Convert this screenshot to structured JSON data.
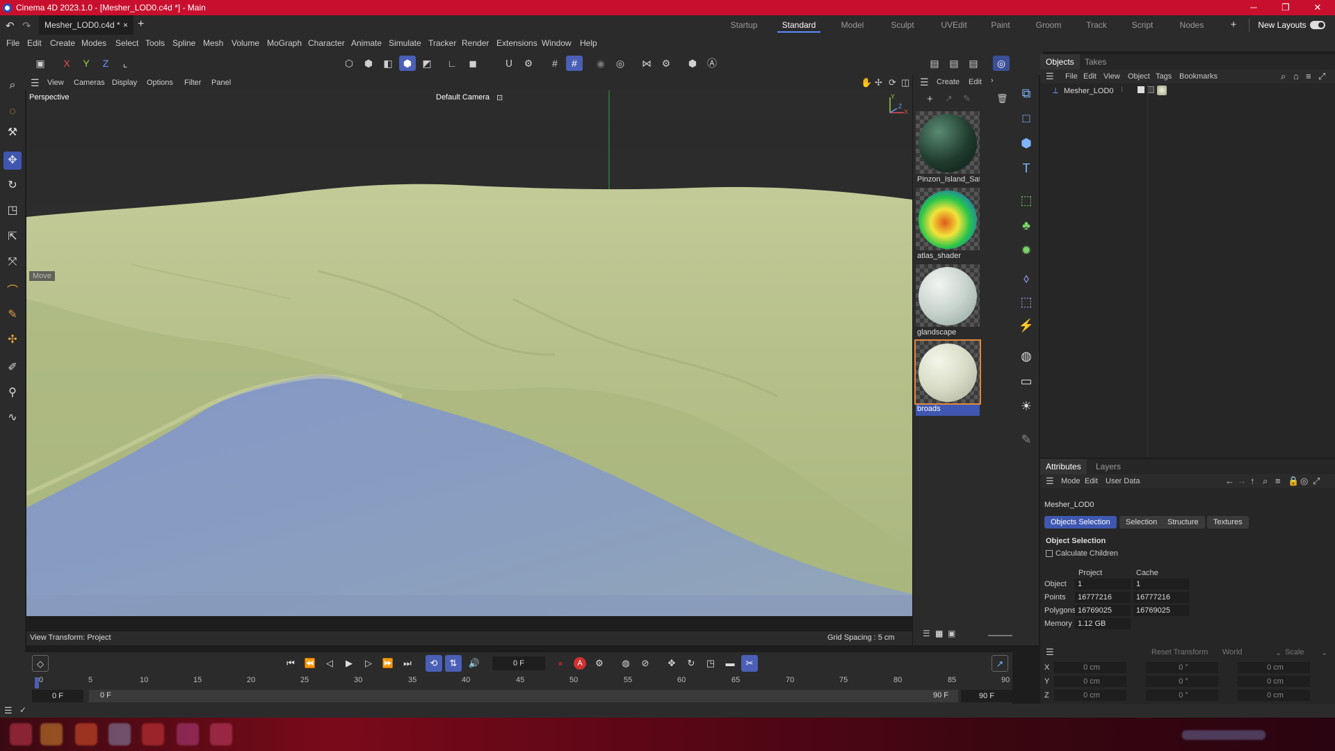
{
  "app": {
    "title": "Cinema 4D 2023.1.0 - [Mesher_LOD0.c4d *] - Main",
    "window_controls": {
      "minimize": "─",
      "restore": "❐",
      "close": "✕"
    }
  },
  "tabs": {
    "document": "Mesher_LOD0.c4d *",
    "close": "×",
    "add": "+",
    "layouts": [
      "Startup",
      "Standard",
      "Model",
      "Sculpt",
      "UVEdit",
      "Paint",
      "Groom",
      "Track",
      "Script",
      "Nodes"
    ],
    "active_layout": "Standard",
    "add_layout": "+",
    "new_layouts": "New Layouts"
  },
  "menu": [
    "File",
    "Edit",
    "Create",
    "Modes",
    "Select",
    "Tools",
    "Spline",
    "Mesh",
    "Volume",
    "MoGraph",
    "Character",
    "Animate",
    "Simulate",
    "Tracker",
    "Render",
    "Extensions",
    "Window",
    "Help"
  ],
  "toolbar": {
    "x": "X",
    "y": "Y",
    "z": "Z"
  },
  "viewport": {
    "menu": [
      "View",
      "Cameras",
      "Display",
      "Options",
      "Filter",
      "Panel"
    ],
    "view_name": "Perspective",
    "camera": "Default Camera",
    "tool_label": "Move",
    "view_transform": "View Transform: Project",
    "grid_spacing": "Grid Spacing : 5 cm",
    "axis": {
      "y": "Y",
      "x": "X",
      "z": "Z"
    }
  },
  "materials": {
    "menu": [
      "Create",
      "Edit"
    ],
    "items": [
      {
        "name": "Pinzon_Island_Sat",
        "selected": false
      },
      {
        "name": "atlas_shader",
        "selected": false
      },
      {
        "name": "glandscape",
        "selected": false
      },
      {
        "name": "broads",
        "selected": true
      }
    ]
  },
  "objects_panel": {
    "tabs": [
      "Objects",
      "Takes"
    ],
    "active_tab": "Objects",
    "menu": [
      "File",
      "Edit",
      "View",
      "Object",
      "Tags",
      "Bookmarks"
    ],
    "objects": [
      {
        "name": "Mesher_LOD0"
      }
    ]
  },
  "attributes": {
    "tabs": [
      "Attributes",
      "Layers"
    ],
    "active_tab": "Attributes",
    "menu": [
      "Mode",
      "Edit",
      "User Data"
    ],
    "object_name": "Mesher_LOD0",
    "subtabs": [
      "Objects Selection",
      "Selection",
      "Structure",
      "Textures"
    ],
    "active_subtab": "Objects Selection",
    "section": "Object Selection",
    "calculate_children": "Calculate Children",
    "columns": [
      "Project",
      "Cache"
    ],
    "rows": [
      {
        "label": "Object",
        "project": "1",
        "cache": "1"
      },
      {
        "label": "Points",
        "project": "16777216",
        "cache": "16777216"
      },
      {
        "label": "Polygons",
        "project": "16769025",
        "cache": "16769025"
      },
      {
        "label": "Memory",
        "project": "1.12 GB",
        "cache": ""
      }
    ]
  },
  "transform": {
    "reset": "Reset Transform",
    "space": "World",
    "mode": "Scale",
    "rows": [
      {
        "axis": "X",
        "pos": "0 cm",
        "rot": "0 °",
        "scale": "0 cm"
      },
      {
        "axis": "Y",
        "pos": "0 cm",
        "rot": "0 °",
        "scale": "0 cm"
      },
      {
        "axis": "Z",
        "pos": "0 cm",
        "rot": "0 °",
        "scale": "0 cm"
      }
    ]
  },
  "timeline": {
    "current_frame": "0 F",
    "ruler": [
      "0",
      "5",
      "10",
      "15",
      "20",
      "25",
      "30",
      "35",
      "40",
      "45",
      "50",
      "55",
      "60",
      "65",
      "70",
      "75",
      "80",
      "85",
      "90"
    ],
    "start": "0 F",
    "range_start": "0 F",
    "range_end": "90 F",
    "end": "90 F",
    "record_label": "A"
  },
  "colors": {
    "accent": "#3f57b0",
    "title_bar": "#c8102e",
    "terrain": "#b9c48f",
    "water": "#8a9ec4"
  }
}
